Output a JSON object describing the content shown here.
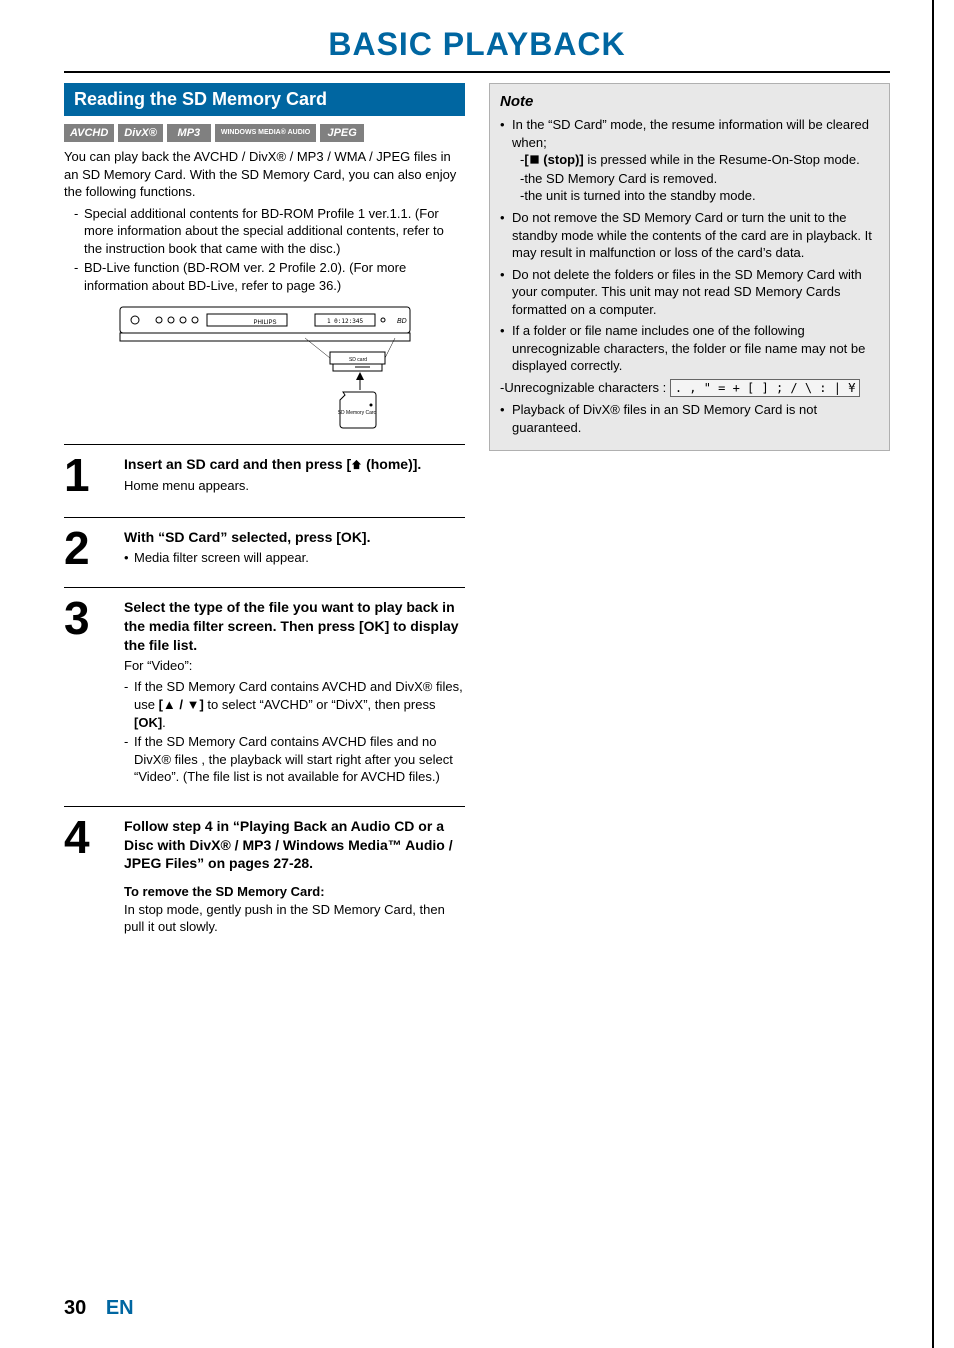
{
  "page": {
    "title": "BASIC PLAYBACK",
    "number": "30",
    "lang": "EN"
  },
  "section": {
    "heading": "Reading the SD Memory Card",
    "badges": [
      "AVCHD",
      "DivX®",
      "MP3",
      "WINDOWS\nMEDIA®\nAUDIO",
      "JPEG"
    ],
    "intro": "You can play back the AVCHD / DivX® / MP3 / WMA / JPEG files in an SD Memory Card. With the SD Memory Card, you can also enjoy the following functions.",
    "intro_items": [
      "Special additional contents for BD-ROM Profile 1 ver.1.1. (For more information about the special additional contents, refer to the instruction book that came with the disc.)",
      "BD-Live function (BD-ROM ver. 2 Profile 2.0). (For more information about BD-Live, refer to page 36.)"
    ],
    "figure": {
      "brand": "PHILIPS",
      "display": "1  0:12:345",
      "slot_label": "SD card",
      "card_label": "SD Memory Card"
    }
  },
  "steps": [
    {
      "num": "1",
      "head_a": "Insert an SD card and then press ",
      "head_b": "[",
      "head_c": " (home)].",
      "sub": "Home menu appears."
    },
    {
      "num": "2",
      "head": "With “SD Card” selected, press [OK].",
      "bullets_dot": [
        "Media filter screen will appear."
      ]
    },
    {
      "num": "3",
      "head": "Select the type of the file you want to play back in the media filter screen. Then press [OK] to display the file list.",
      "sub": "For “Video”:",
      "bullets_dash": [
        {
          "pre": "If the SD Memory Card contains AVCHD and DivX® files, use ",
          "bold1": "[▲ / ▼]",
          "mid": " to select “AVCHD” or “DivX”, then press ",
          "bold2": "[OK]",
          "post": "."
        },
        {
          "text": "If the SD Memory Card contains AVCHD files and no DivX® files , the playback will start right after you select “Video”. (The file list is not available for AVCHD files.)"
        }
      ]
    },
    {
      "num": "4",
      "head": "Follow step 4 in “Playing Back an Audio CD or a Disc with DivX® / MP3 / Windows Media™ Audio / JPEG Files” on pages 27-28.",
      "remove_title": "To remove the SD Memory Card:",
      "remove_body": "In stop mode, gently push in the SD Memory Card, then pull it out slowly."
    }
  ],
  "note": {
    "title": "Note",
    "items": [
      {
        "text": "In the “SD Card” mode, the resume information will be cleared when;",
        "subs": [
          {
            "prefix": "-",
            "bold_a": "[",
            "stop_label": " (stop)]",
            "rest": " is pressed while in the Resume-On-Stop mode."
          },
          {
            "prefix": "-",
            "text": "the SD Memory Card is removed."
          },
          {
            "prefix": "-",
            "text": "the unit is turned into the standby mode."
          }
        ]
      },
      {
        "text": "Do not remove the SD Memory Card or turn the unit to the standby mode while the contents of the card are in playback. It may result in malfunction or loss of the card’s data."
      },
      {
        "text": "Do not delete the folders or files in the SD Memory Card with your computer. This unit may not read SD Memory Cards formatted on a computer."
      },
      {
        "text": "If a folder or file name includes one of the following unrecognizable characters, the folder or file name may not be displayed correctly."
      },
      {
        "is_chars": true,
        "label": "-Unrecognizable characters : ",
        "chars": ". , \" = + [ ] ; / \\ : | ¥"
      },
      {
        "text": "Playback of DivX® files in an SD Memory Card is not guaranteed."
      }
    ]
  }
}
